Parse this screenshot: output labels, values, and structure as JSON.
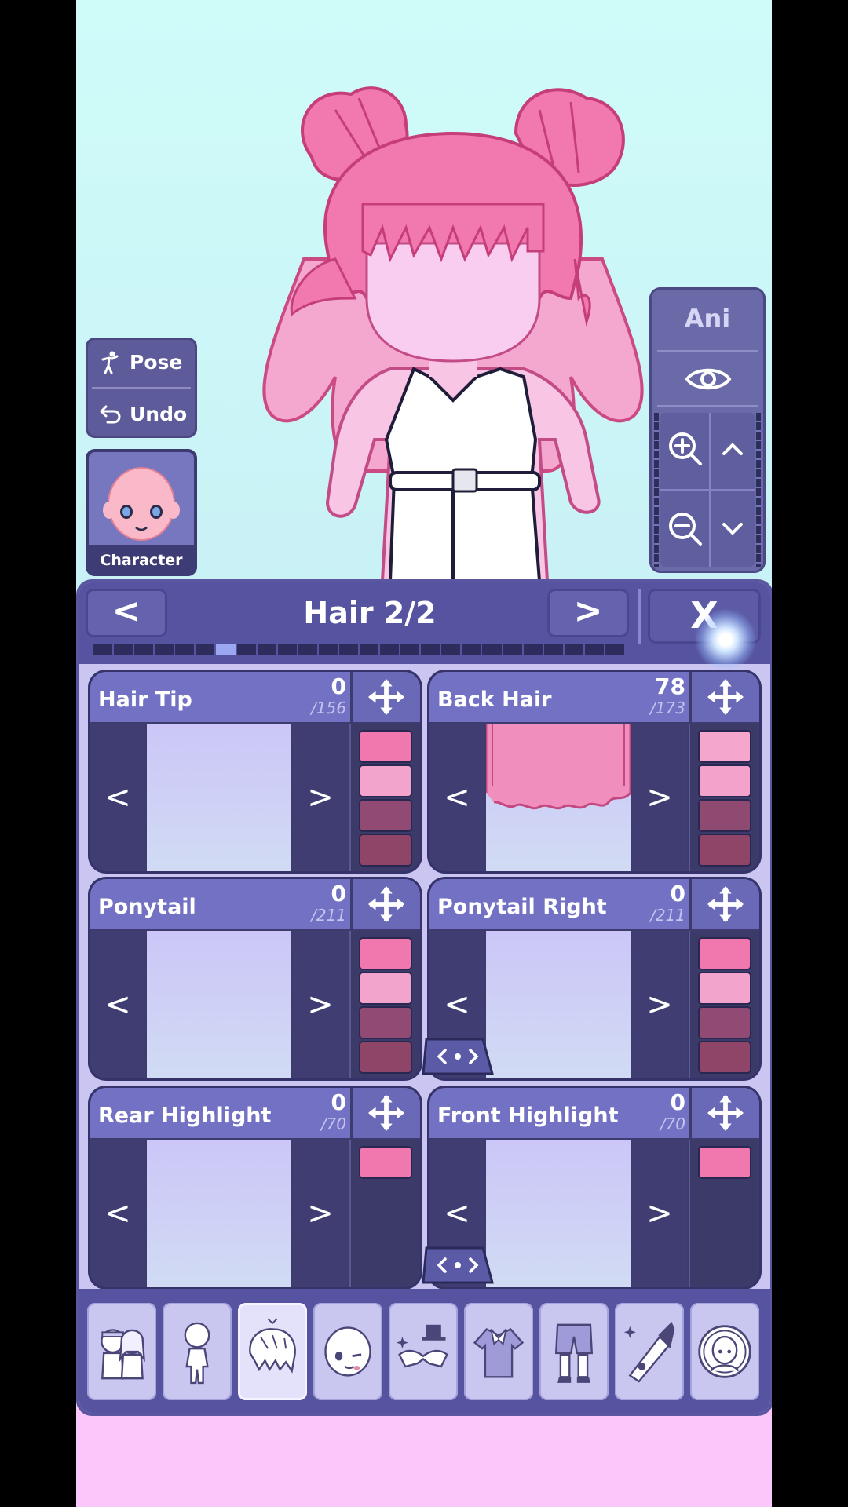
{
  "left_controls": {
    "pose_label": "Pose",
    "undo_label": "Undo",
    "character_label": "Character"
  },
  "right_controls": {
    "ani_label": "Ani"
  },
  "editor": {
    "title": "Hair 2/2",
    "prev_label": "<",
    "next_label": ">",
    "close_label": "X",
    "progress": {
      "segments": 26,
      "active_index": 6
    }
  },
  "cards": [
    {
      "name": "Hair Tip",
      "value": "0",
      "total": "/156",
      "prev": "<",
      "next": ">",
      "swatches": [
        "#f178ae",
        "#f3a4cc",
        "#904a74",
        "#8e4568"
      ]
    },
    {
      "name": "Back Hair",
      "value": "78",
      "total": "/173",
      "prev": "<",
      "next": ">",
      "swatches": [
        "#f5a6cc",
        "#f3a3cb",
        "#8f4a71",
        "#8e4568"
      ]
    },
    {
      "name": "Ponytail",
      "value": "0",
      "total": "/211",
      "prev": "<",
      "next": ">",
      "swatches": [
        "#f178ae",
        "#f3a4cc",
        "#904a74",
        "#8e4568"
      ]
    },
    {
      "name": "Ponytail Right",
      "value": "0",
      "total": "/211",
      "prev": "<",
      "next": ">",
      "swatches": [
        "#f178ae",
        "#f3a4cc",
        "#904a74",
        "#8e4568"
      ]
    },
    {
      "name": "Rear Highlight",
      "value": "0",
      "total": "/70",
      "prev": "<",
      "next": ">",
      "swatches": [
        "#f178ae"
      ]
    },
    {
      "name": "Front Highlight",
      "value": "0",
      "total": "/70",
      "prev": "<",
      "next": ">",
      "swatches": [
        "#f178ae"
      ]
    }
  ],
  "colors": {
    "accent": "#5654a0",
    "card_header": "#7271c4",
    "hair_pink": "#f48fc1",
    "background_top": "#cffcf9",
    "floor_pink": "#fbc7fa"
  },
  "toolbar_icons": [
    "presets-icon",
    "body-icon",
    "hair-icon",
    "face-icon",
    "accessory-icon",
    "top-icon",
    "bottom-icon",
    "props-icon",
    "profile-icon"
  ]
}
